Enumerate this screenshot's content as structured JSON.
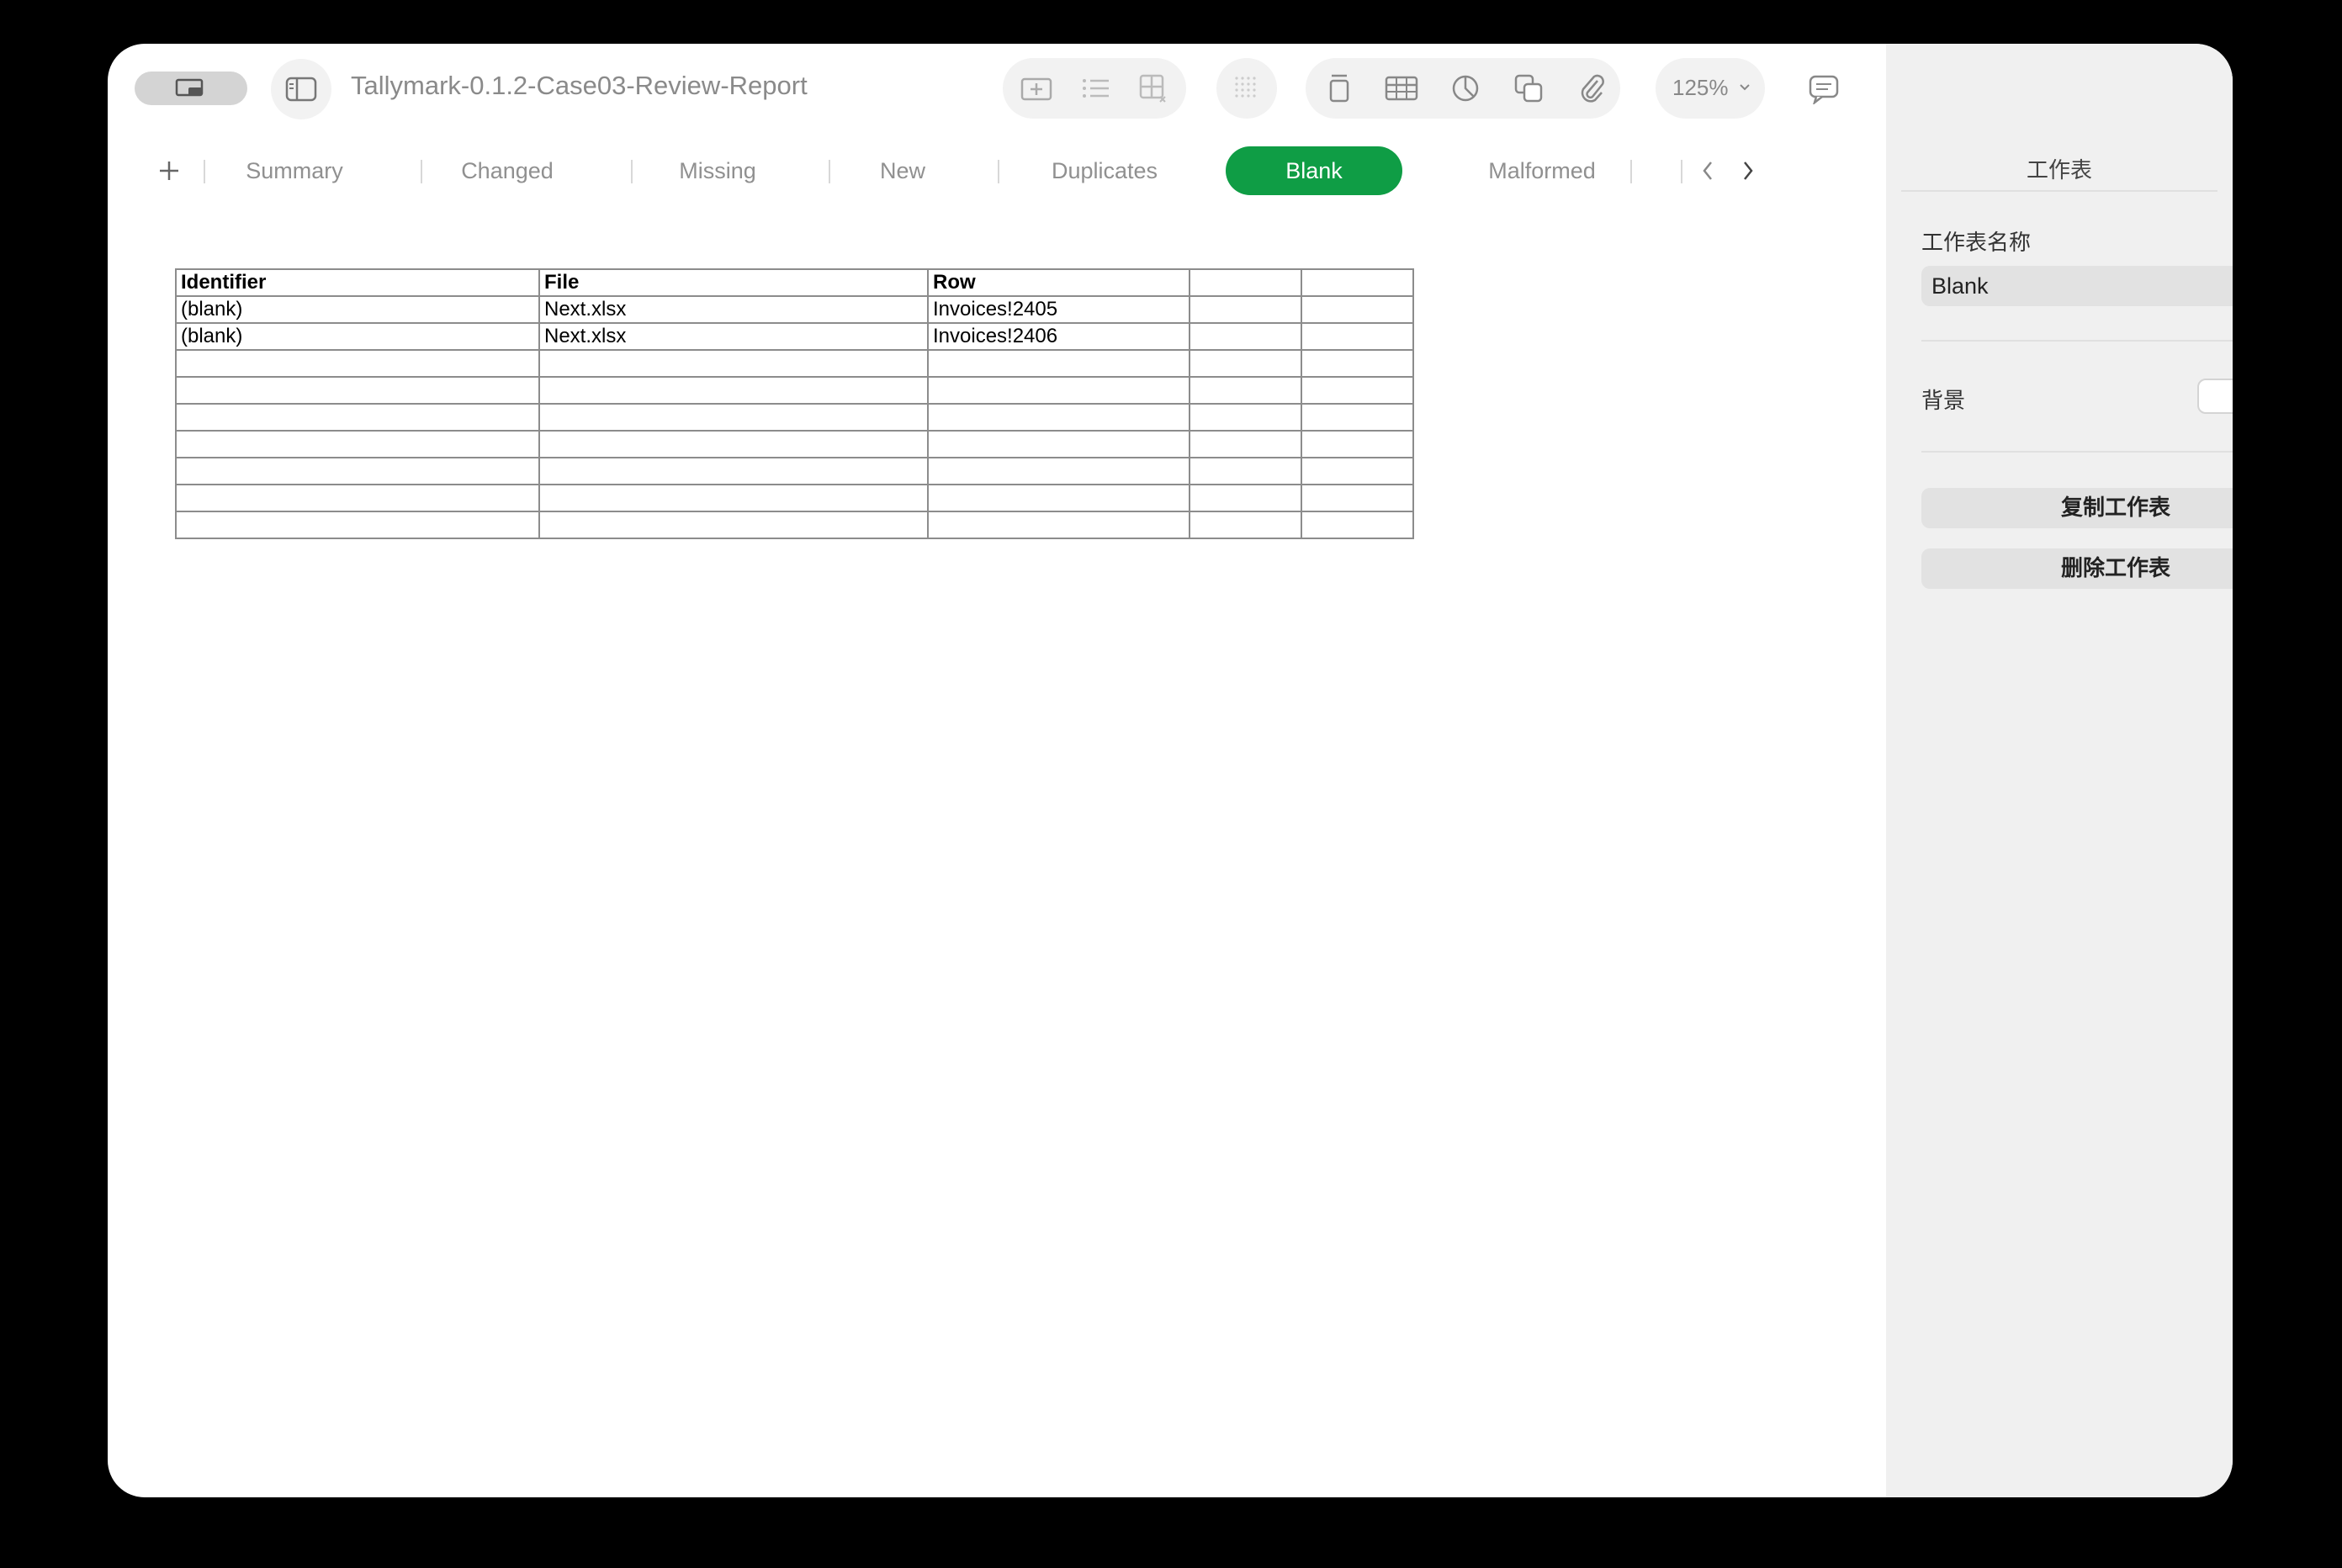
{
  "window": {
    "title": "Tallymark-0.1.2-Case03-Review-Report",
    "zoom": "125%"
  },
  "toolbar": {
    "icons": [
      "view-mode-icon",
      "sidebar-toggle-icon",
      "insert-icon",
      "list-icon",
      "table-layout-icon",
      "grid-icon",
      "text-icon",
      "table-icon",
      "chart-icon",
      "shape-icon",
      "attachment-icon",
      "comment-icon",
      "share-icon",
      "format-brush-icon",
      "organize-icon"
    ]
  },
  "tabs": {
    "add_label": "+",
    "items": [
      {
        "label": "Summary"
      },
      {
        "label": "Changed"
      },
      {
        "label": "Missing"
      },
      {
        "label": "New"
      },
      {
        "label": "Duplicates"
      },
      {
        "label": "Blank"
      },
      {
        "label": "Malformed"
      }
    ],
    "active": "Blank",
    "active_color": "#0f9d45"
  },
  "sheet": {
    "headers": [
      "Identifier",
      "File",
      "Row",
      "",
      ""
    ],
    "rows": [
      [
        "(blank)",
        "Next.xlsx",
        "Invoices!2405",
        "",
        ""
      ],
      [
        "(blank)",
        "Next.xlsx",
        "Invoices!2406",
        "",
        ""
      ]
    ]
  },
  "sidebar": {
    "title": "工作表",
    "name_label": "工作表名称",
    "name_value": "Blank",
    "background_label": "背景",
    "duplicate_button": "复制工作表",
    "delete_button": "删除工作表"
  }
}
